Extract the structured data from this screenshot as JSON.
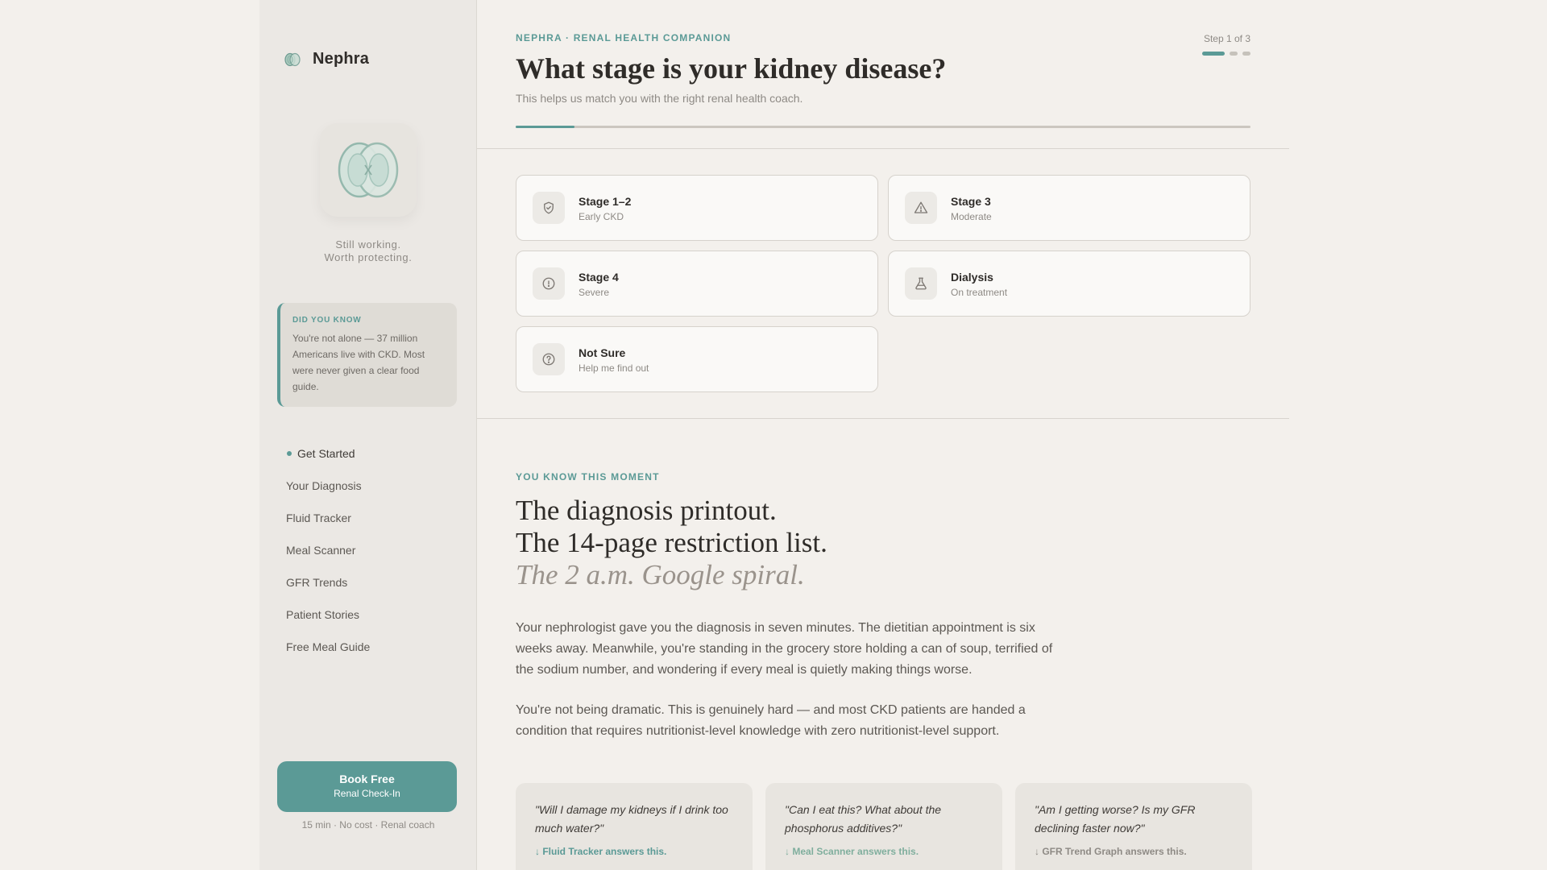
{
  "brand": {
    "name": "Nephra"
  },
  "sidebar": {
    "tagline_line1": "Still working.",
    "tagline_line2": "Worth protecting.",
    "did_you_know": {
      "title": "DID YOU KNOW",
      "text": "You're not alone — 37 million Americans live with CKD. Most were never given a clear food guide."
    },
    "nav": [
      {
        "label": "Get Started",
        "active": true
      },
      {
        "label": "Your Diagnosis"
      },
      {
        "label": "Fluid Tracker"
      },
      {
        "label": "Meal Scanner"
      },
      {
        "label": "GFR Trends"
      },
      {
        "label": "Patient Stories"
      },
      {
        "label": "Free Meal Guide"
      }
    ],
    "cta": {
      "main": "Book Free",
      "sub": "Renal Check-In",
      "note": "15 min · No cost · Renal coach"
    }
  },
  "header": {
    "eyebrow": "NEPHRA · RENAL HEALTH COMPANION",
    "title": "What stage is your kidney disease?",
    "subtitle": "This helps us match you with the right renal health coach.",
    "step_text": "Step 1 of 3",
    "progress_fraction": 0.08
  },
  "options": [
    {
      "label": "Stage 1–2",
      "sub": "Early CKD",
      "icon": "shield-check-icon"
    },
    {
      "label": "Stage 3",
      "sub": "Moderate",
      "icon": "warning-triangle-icon"
    },
    {
      "label": "Stage 4",
      "sub": "Severe",
      "icon": "alert-circle-icon"
    },
    {
      "label": "Dialysis",
      "sub": "On treatment",
      "icon": "flask-icon"
    },
    {
      "label": "Not Sure",
      "sub": "Help me find out",
      "icon": "question-circle-icon"
    }
  ],
  "moment": {
    "eyebrow": "YOU KNOW THIS MOMENT",
    "line1": "The diagnosis printout.",
    "line2": "The 14-page restriction list.",
    "line3": "The 2 a.m. Google spiral.",
    "para1": "Your nephrologist gave you the diagnosis in seven minutes. The dietitian appointment is six weeks away. Meanwhile, you're standing in the grocery store holding a can of soup, terrified of the sodium number, and wondering if every meal is quietly making things worse.",
    "para2": "You're not being dramatic. This is genuinely hard — and most CKD patients are handed a condition that requires nutritionist-level knowledge with zero nutritionist-level support."
  },
  "quotes": [
    {
      "text": "\"Will I damage my kidneys if I drink too much water?\"",
      "link": "↓ Fluid Tracker answers this.",
      "color": "#5b9a96"
    },
    {
      "text": "\"Can I eat this? What about the phosphorus additives?\"",
      "link": "↓ Meal Scanner answers this.",
      "color": "#7fae9d"
    },
    {
      "text": "\"Am I getting worse? Is my GFR declining faster now?\"",
      "link": "↓ GFR Trend Graph answers this.",
      "color": "#8e8a85"
    }
  ],
  "colors": {
    "accent": "#5b9a96",
    "background": "#f3f0ec",
    "sidebar": "#ebe8e4"
  }
}
